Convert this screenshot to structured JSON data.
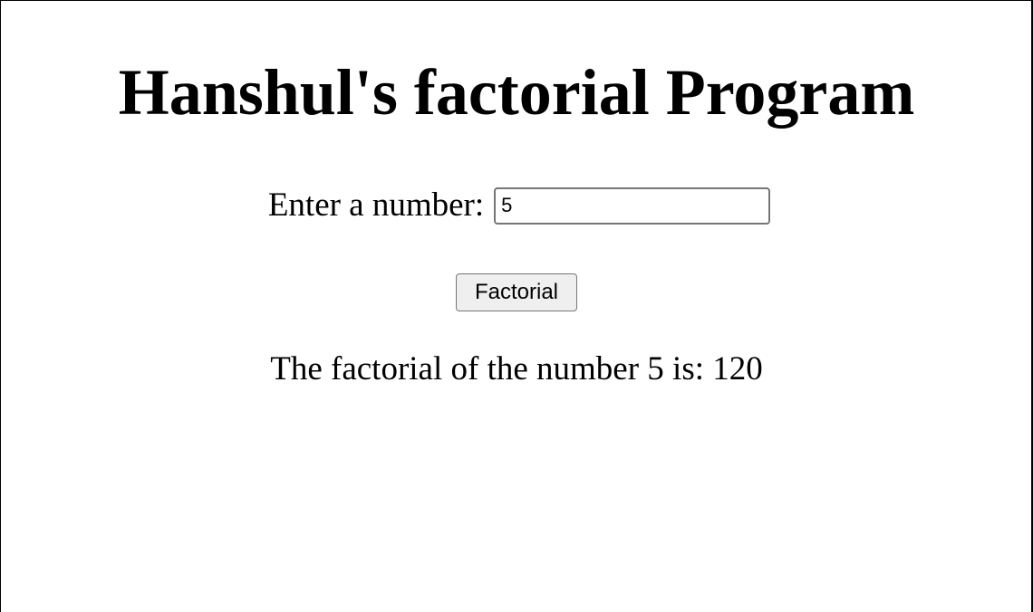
{
  "page": {
    "title": "Hanshul's factorial Program"
  },
  "form": {
    "label": "Enter a number:",
    "input_value": "5",
    "button_label": "Factorial"
  },
  "result": {
    "text": "The factorial of the number 5 is: 120"
  }
}
